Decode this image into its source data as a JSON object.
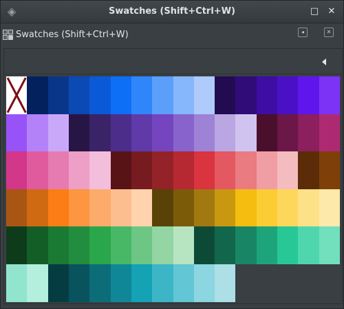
{
  "window": {
    "title": "Swatches (Shift+Ctrl+W)",
    "maximize_glyph": "□",
    "close_glyph": "✕"
  },
  "dock": {
    "tab_title": "Swatches (Shift+Ctrl+W)",
    "detach_glyph": "◂",
    "close_glyph": "✕"
  },
  "swatches": [
    "none",
    "#03215c",
    "#0a3689",
    "#0b49b5",
    "#0a5ad7",
    "#0d6ff5",
    "#2f86fb",
    "#5c9ffa",
    "#86b7fc",
    "#aecbfc",
    "#230b52",
    "#2f0c77",
    "#3e0da3",
    "#4a10c6",
    "#5f16ec",
    "#7c33f5",
    "#9753f7",
    "#b382f8",
    "#c9a8f9",
    "#271645",
    "#3b2368",
    "#4c2e8a",
    "#603aa8",
    "#7445bf",
    "#8863cc",
    "#9e82d6",
    "#b9a6e2",
    "#d1c3ef",
    "#4a0f2c",
    "#6b1747",
    "#8c1f5d",
    "#ad2a73",
    "#d23789",
    "#e05a9e",
    "#e67bb1",
    "#ee9fc7",
    "#f3bedb",
    "#581317",
    "#761c21",
    "#932329",
    "#b62932",
    "#d93440",
    "#e35861",
    "#ea7b81",
    "#f09ea3",
    "#f4bcbf",
    "#5b2c07",
    "#7f3f08",
    "#a95614",
    "#d06a12",
    "#fb7d13",
    "#fd9541",
    "#fdab6b",
    "#fdbe8f",
    "#fed3ad",
    "#5a4207",
    "#7b5b08",
    "#a17910",
    "#c89910",
    "#f5bd10",
    "#fbcc34",
    "#fdd65c",
    "#fde187",
    "#fde9a9",
    "#0e3c1b",
    "#135e27",
    "#1a7a34",
    "#228d3f",
    "#2aa74b",
    "#49b866",
    "#6dc684",
    "#93d5a3",
    "#b7e4c1",
    "#0d4a36",
    "#12664c",
    "#188664",
    "#1ea47b",
    "#27c896",
    "#4fd6ad",
    "#72dfbd",
    "#91e5cd",
    "#b4eedd",
    "#053c42",
    "#08535d",
    "#0c6d79",
    "#108796",
    "#14a2b4",
    "#3cb6c7",
    "#62c6d4",
    "#8bd6e0",
    "#addfe6"
  ]
}
